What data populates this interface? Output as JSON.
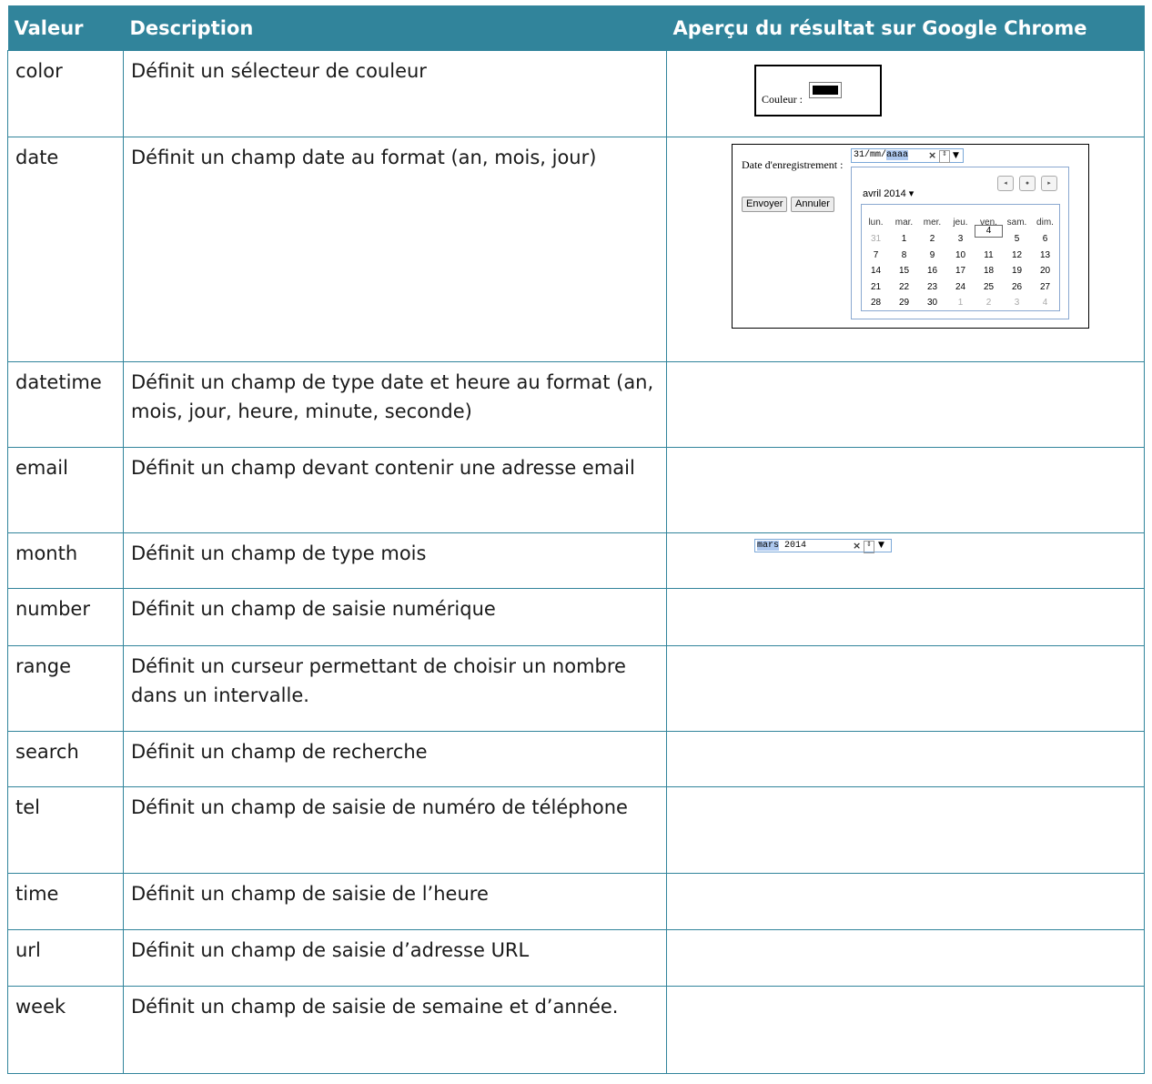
{
  "headers": [
    "Valeur",
    "Description",
    "Aperçu du résultat sur Google Chrome"
  ],
  "rows": [
    {
      "value": "color",
      "desc": "Définit un sélecteur de couleur"
    },
    {
      "value": "date",
      "desc": "Définit un champ date au format (an, mois, jour)"
    },
    {
      "value": "datetime",
      "desc": "Définit un champ de type date et heure au format (an, mois, jour, heure, minute, seconde)"
    },
    {
      "value": "email",
      "desc": "Définit un champ devant contenir une adresse email"
    },
    {
      "value": "month",
      "desc": "Définit un champ de type mois"
    },
    {
      "value": "number",
      "desc": "Définit un champ de saisie numérique"
    },
    {
      "value": "range",
      "desc": "Définit un curseur permettant de choisir un nombre dans un intervalle."
    },
    {
      "value": "search",
      "desc": "Définit un champ de recherche"
    },
    {
      "value": "tel",
      "desc": "Définit un champ de saisie de numéro de téléphone"
    },
    {
      "value": "time",
      "desc": "Définit un champ de saisie de l’heure"
    },
    {
      "value": "url",
      "desc": "Définit un champ de saisie d’adresse URL"
    },
    {
      "value": "week",
      "desc": "Définit un champ de saisie de semaine et d’année."
    }
  ],
  "color_preview": {
    "label": "Couleur :",
    "swatch_color": "#000000"
  },
  "date_preview": {
    "label": "Date d'enregistrement :",
    "value_plain": "31/mm/",
    "value_selected": "aaaa",
    "clear": "×",
    "spin": "⇕",
    "dropdown": "▼",
    "send_button": "Envoyer",
    "cancel_button": "Annuler",
    "calendar": {
      "month_label": "avril 2014 ▾",
      "nav": [
        "◂",
        "●",
        "▸"
      ],
      "weekdays": [
        "lun.",
        "mar.",
        "mer.",
        "jeu.",
        "ven.",
        "sam.",
        "dim."
      ],
      "weeks": [
        [
          "31",
          "1",
          "2",
          "3",
          "4",
          "5",
          "6"
        ],
        [
          "7",
          "8",
          "9",
          "10",
          "11",
          "12",
          "13"
        ],
        [
          "14",
          "15",
          "16",
          "17",
          "18",
          "19",
          "20"
        ],
        [
          "21",
          "22",
          "23",
          "24",
          "25",
          "26",
          "27"
        ],
        [
          "28",
          "29",
          "30",
          "1",
          "2",
          "3",
          "4"
        ]
      ],
      "today": "4"
    }
  },
  "month_preview": {
    "value_selected": "mars",
    "value_plain": " 2014",
    "clear": "×",
    "dropdown": "▼"
  },
  "colors": {
    "header_bg": "#31849b",
    "border": "#31849b",
    "selection": "#adc8ef"
  }
}
